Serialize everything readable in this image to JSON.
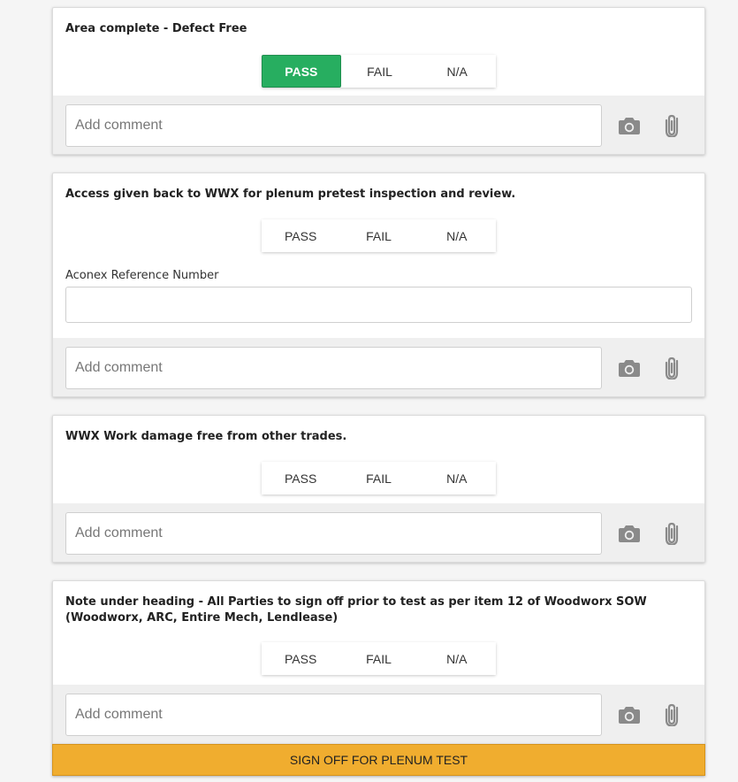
{
  "items": [
    {
      "question": "Area complete - Defect Free",
      "options": [
        "PASS",
        "FAIL",
        "N/A"
      ],
      "selected": "PASS",
      "comment_placeholder": "Add comment"
    },
    {
      "question": "Access given back to WWX for plenum pretest inspection and review.",
      "options": [
        "PASS",
        "FAIL",
        "N/A"
      ],
      "selected": null,
      "field_label": "Aconex Reference Number",
      "field_value": "",
      "comment_placeholder": "Add comment"
    },
    {
      "question": "WWX Work damage free from other trades.",
      "options": [
        "PASS",
        "FAIL",
        "N/A"
      ],
      "selected": null,
      "comment_placeholder": "Add comment"
    },
    {
      "question": "Note under heading - All Parties to sign off prior to test as per item 12 of Woodworx SOW (Woodworx, ARC, Entire Mech, Lendlease)",
      "options": [
        "PASS",
        "FAIL",
        "N/A"
      ],
      "selected": null,
      "comment_placeholder": "Add comment"
    }
  ],
  "signoff_label": "SIGN OFF FOR PLENUM TEST",
  "icons": {
    "camera": "camera-icon",
    "attach": "paperclip-icon"
  },
  "colors": {
    "pass_active": "#27ae60",
    "signoff": "#f0ad2f",
    "background": "#f5f5f5"
  }
}
